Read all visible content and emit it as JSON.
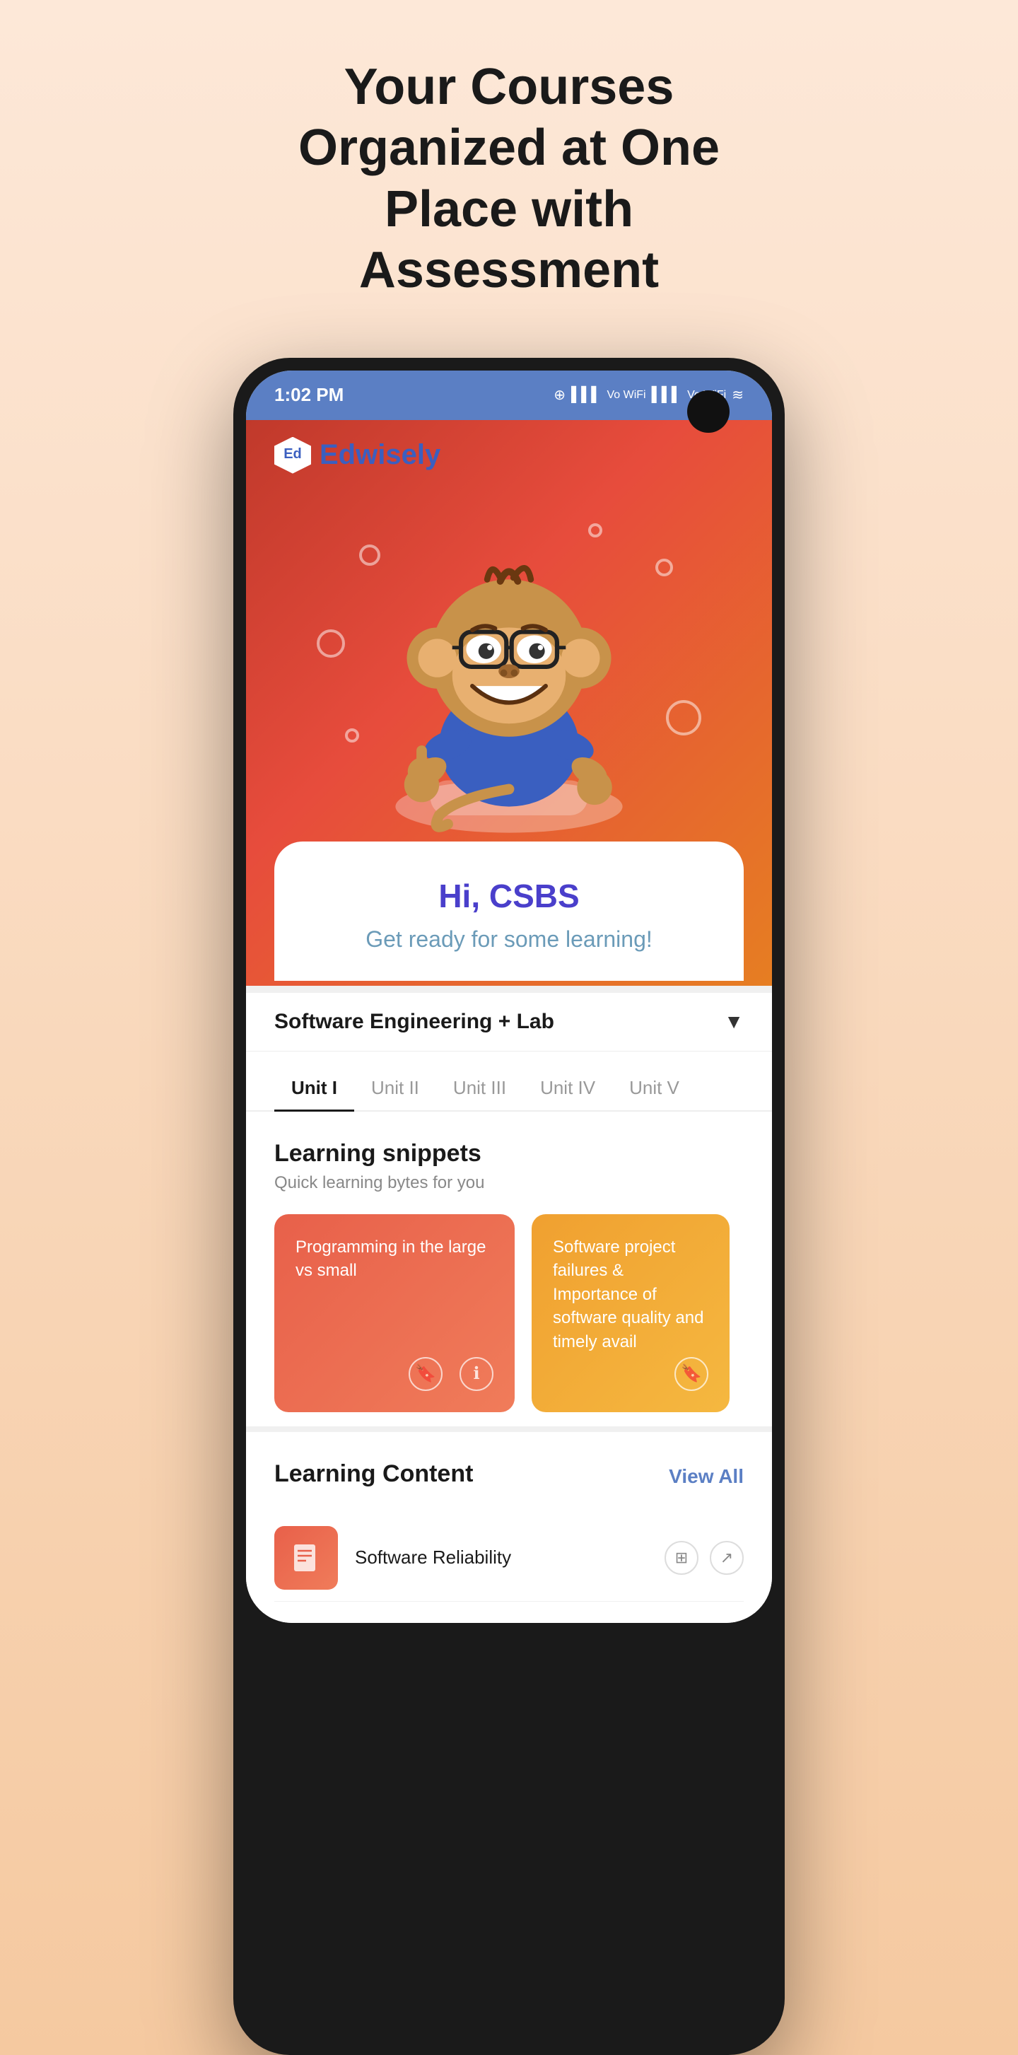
{
  "hero": {
    "title": "Your Courses Organized at One Place with Assessment"
  },
  "statusBar": {
    "time": "1:02 PM",
    "icons": "🔵 📶 Vo WiFi 📶 Vo WiFi 📶"
  },
  "app": {
    "logoText1": "Ed",
    "logoText2": "wisely"
  },
  "greeting": {
    "name": "Hi, CSBS",
    "subtitle": "Get ready for some learning!"
  },
  "courseSelector": {
    "courseName": "Software Engineering + Lab",
    "chevron": "▼"
  },
  "unitTabs": [
    {
      "label": "Unit I",
      "active": true
    },
    {
      "label": "Unit II",
      "active": false
    },
    {
      "label": "Unit III",
      "active": false
    },
    {
      "label": "Unit IV",
      "active": false
    },
    {
      "label": "Unit V",
      "active": false
    }
  ],
  "learningSnippets": {
    "title": "Learning snippets",
    "subtitle": "Quick learning bytes for you",
    "cards": [
      {
        "text": "Programming in the large vs small",
        "gradient": "salmon"
      },
      {
        "text": "Software project failures & Importance of software quality and timely avail",
        "gradient": "orange"
      }
    ]
  },
  "learningContent": {
    "title": "Learning Content",
    "viewAll": "View All",
    "items": [
      {
        "title": "Software Reliability"
      }
    ]
  }
}
